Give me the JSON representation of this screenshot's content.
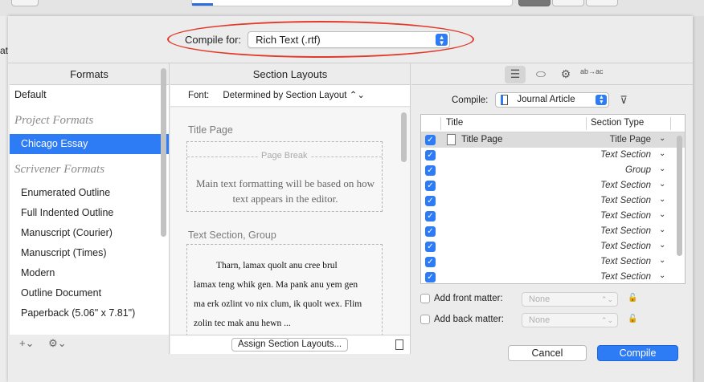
{
  "background": {
    "left_fragment": "at"
  },
  "compile_for": {
    "label": "Compile for:",
    "value": "Rich Text (.rtf)"
  },
  "formats": {
    "header": "Formats",
    "items": [
      {
        "label": "Default",
        "kind": "plain"
      },
      {
        "label": "Project Formats",
        "kind": "group"
      },
      {
        "label": "Chicago Essay",
        "kind": "item",
        "selected": true
      },
      {
        "label": "Scrivener Formats",
        "kind": "group"
      },
      {
        "label": "Enumerated Outline",
        "kind": "item"
      },
      {
        "label": "Full Indented Outline",
        "kind": "item"
      },
      {
        "label": "Manuscript (Courier)",
        "kind": "item"
      },
      {
        "label": "Manuscript (Times)",
        "kind": "item"
      },
      {
        "label": "Modern",
        "kind": "item"
      },
      {
        "label": "Outline Document",
        "kind": "item"
      },
      {
        "label": "Paperback (5.06\" x 7.81\")",
        "kind": "item"
      }
    ],
    "footer": {
      "add": "+⌄",
      "gear": "⚙⌄"
    }
  },
  "layouts": {
    "header": "Section Layouts",
    "font_label": "Font:",
    "font_value": "Determined by Section Layout",
    "title_page": {
      "label": "Title Page",
      "page_break": "Page Break",
      "text": "Main text formatting will be based on how text appears in the editor."
    },
    "text_section": {
      "label": "Text Section, Group",
      "lines": [
        "Tharn, lamax quolt anu cree brul",
        "lamax teng whik gen. Ma pank anu yem gen",
        "ma erk ozlint vo nix clum, ik quolt wex. Flim",
        "zolin tec mak anu hewn ..."
      ]
    },
    "assign_button": "Assign Section Layouts..."
  },
  "right": {
    "tabs": [
      "☰",
      "⬭",
      "⚙",
      "ab→ac"
    ],
    "compile_label": "Compile:",
    "compile_value": "Journal Article",
    "table": {
      "headers": [
        "Title",
        "Section Type"
      ],
      "rows": [
        {
          "title": "Title Page",
          "type": "Title Page"
        },
        {
          "title": "",
          "type": "Text Section"
        },
        {
          "title": "",
          "type": "Group"
        },
        {
          "title": "",
          "type": "Text Section"
        },
        {
          "title": "",
          "type": "Text Section"
        },
        {
          "title": "",
          "type": "Text Section"
        },
        {
          "title": "",
          "type": "Text Section"
        },
        {
          "title": "",
          "type": "Text Section"
        },
        {
          "title": "",
          "type": "Text Section"
        },
        {
          "title": "",
          "type": "Text Section"
        }
      ]
    },
    "front_matter": {
      "label": "Add front matter:",
      "value": "None"
    },
    "back_matter": {
      "label": "Add back matter:",
      "value": "None"
    }
  },
  "buttons": {
    "cancel": "Cancel",
    "compile": "Compile"
  },
  "colors": {
    "accent": "#2d7cf6",
    "highlight": "#e23a2a"
  }
}
